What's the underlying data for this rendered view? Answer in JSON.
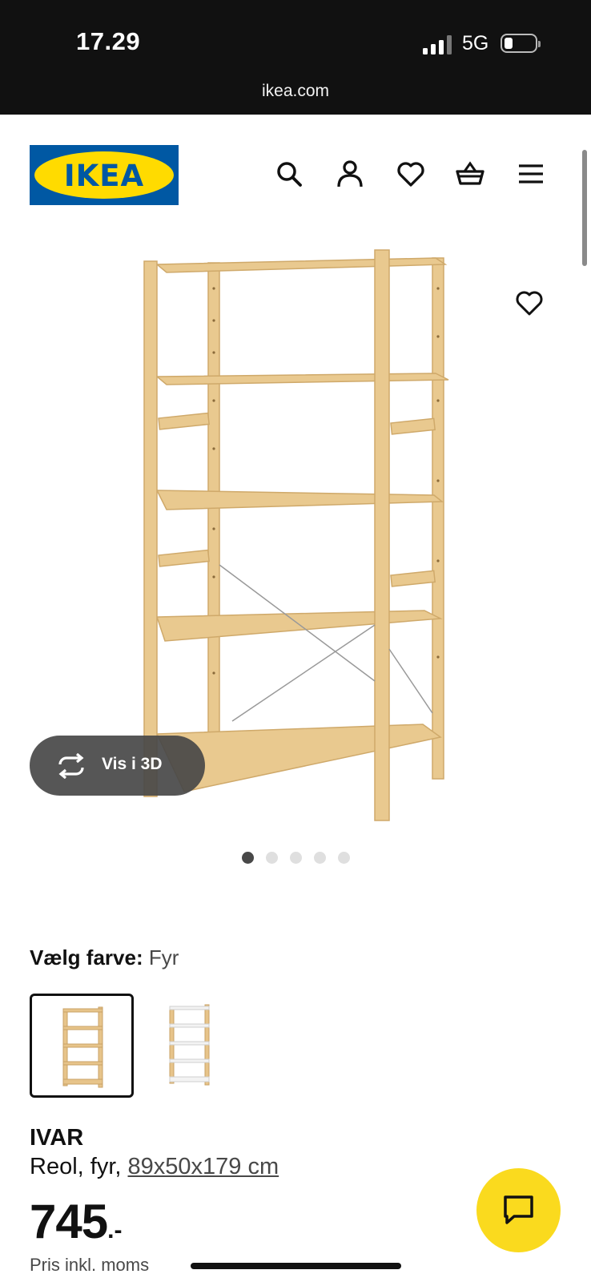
{
  "status_bar": {
    "time": "17.29",
    "network": "5G",
    "signal_icon": "signal-bars-icon",
    "battery_icon": "battery-low-icon"
  },
  "browser": {
    "url": "ikea.com"
  },
  "header": {
    "logo_text": "IKEA",
    "brand_colors": {
      "blue": "#0058a3",
      "yellow": "#ffdb00"
    },
    "icons": [
      "search-icon",
      "account-icon",
      "favourites-icon",
      "basket-icon",
      "menu-icon"
    ]
  },
  "gallery": {
    "view_3d_label": "Vis i 3D",
    "slide_count": 5,
    "active_slide": 1,
    "wood_color": "#e9c98f"
  },
  "color_picker": {
    "label": "Vælg farve:",
    "selected_value": "Fyr",
    "options": [
      {
        "name": "Fyr",
        "selected": true
      },
      {
        "name": "Fyr/hvid",
        "selected": false
      }
    ]
  },
  "product": {
    "name": "IVAR",
    "description": "Reol, fyr, ",
    "dimensions_link": "89x50x179 cm",
    "price": "745",
    "price_suffix": ".-",
    "price_note": "Pris inkl. moms"
  },
  "chat": {
    "icon": "chat-icon",
    "color": "#fada1e"
  }
}
